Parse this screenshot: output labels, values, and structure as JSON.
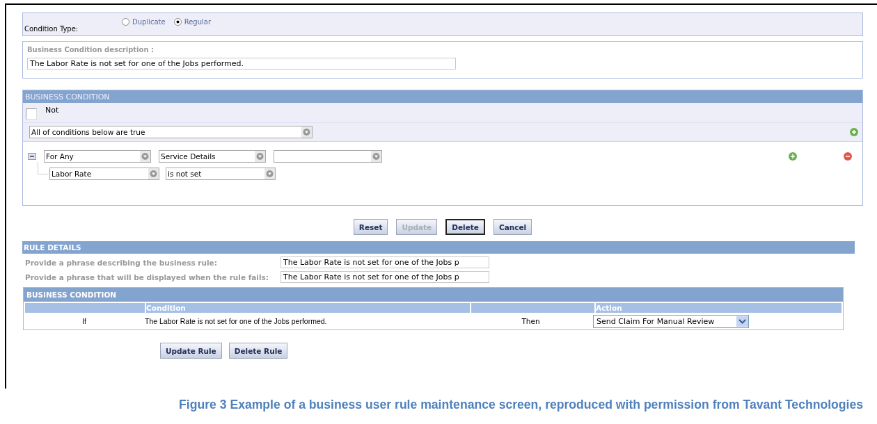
{
  "condition_type": {
    "label": "Condition Type:",
    "options": [
      {
        "label": "Duplicate",
        "selected": false
      },
      {
        "label": "Regular",
        "selected": true
      }
    ]
  },
  "description": {
    "label": "Business Condition description :",
    "value": "The Labor Rate is not set for one of the Jobs performed."
  },
  "business_condition": {
    "title": "BUSINESS CONDITION",
    "not": {
      "label": "Not",
      "checked": false
    },
    "group_select": {
      "value": "All of conditions below are true"
    },
    "clauses": [
      {
        "expanded": true,
        "selects": [
          {
            "kind": "dropdown",
            "value": "For Any"
          },
          {
            "kind": "dropdown",
            "value": "Service Details"
          },
          {
            "kind": "dropdown"
          }
        ],
        "children": [
          {
            "selects": [
              {
                "kind": "dropdown",
                "value": "Labor Rate"
              },
              {
                "kind": "dropdown",
                "value": "is not set"
              }
            ]
          }
        ]
      }
    ]
  },
  "actions": [
    {
      "label": "Reset",
      "disabled": false,
      "focused": false
    },
    {
      "label": "Update",
      "disabled": true,
      "focused": false
    },
    {
      "label": "Delete",
      "disabled": false,
      "focused": true
    },
    {
      "label": "Cancel",
      "disabled": false,
      "focused": false
    }
  ],
  "rule_details": {
    "title": "RULE DETAILS",
    "fields": [
      {
        "label": "Provide a phrase describing the business rule:",
        "value": "The Labor Rate is not set for one of the Jobs p"
      },
      {
        "label": "Provide a phrase that will be displayed when the rule fails:",
        "value": "The Labor Rate is not set for one of the Jobs p"
      }
    ]
  },
  "condition_table": {
    "title": "BUSINESS CONDITION",
    "columns": [
      {
        "label": "Condition"
      },
      {
        "label": "Action"
      }
    ],
    "rows": [
      {
        "prefix": "If",
        "condition": "The Labor Rate is not set for one of the Jobs performed.",
        "connector": "Then",
        "action": "Send Claim For Manual Review"
      }
    ]
  },
  "rule_buttons": [
    {
      "label": "Update Rule"
    },
    {
      "label": "Delete Rule"
    }
  ],
  "caption": "Figure 3 Example of a business user rule maintenance screen, reproduced with permission from Tavant Technologies"
}
